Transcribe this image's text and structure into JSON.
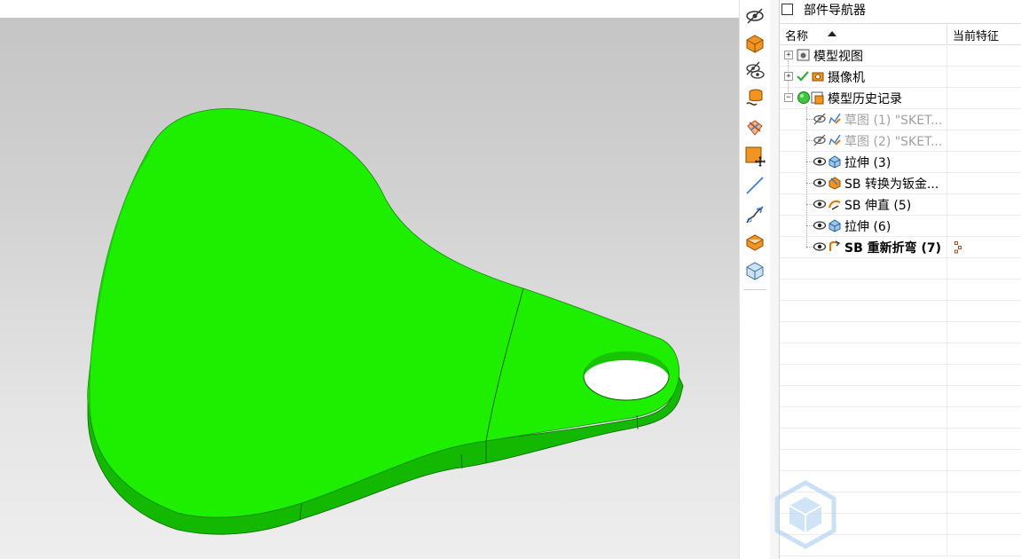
{
  "navigator": {
    "title": "部件导航器",
    "columns": {
      "name": "名称",
      "current_feature": "当前特征"
    },
    "rows": [
      {
        "label": "模型视图",
        "icon": "model-views-icon",
        "expander": "+",
        "style": "normal"
      },
      {
        "label": "摄像机",
        "icon": "camera-icon",
        "expander": "+",
        "style": "normal"
      },
      {
        "label": "模型历史记录",
        "icon": "model-history-icon",
        "expander": "−",
        "style": "normal"
      },
      {
        "label": "草图 (1) \"SKET...",
        "icon": "sketch-icon",
        "visibility": "hidden-eye-icon",
        "style": "dim"
      },
      {
        "label": "草图 (2) \"SKET...",
        "icon": "sketch-icon",
        "visibility": "hidden-eye-icon",
        "style": "dim"
      },
      {
        "label": "拉伸 (3)",
        "icon": "extrude-icon",
        "visibility": "eye-icon",
        "style": "normal"
      },
      {
        "label": "SB 转换为钣金...",
        "icon": "convert-to-sheetmetal-icon",
        "visibility": "eye-icon",
        "style": "normal"
      },
      {
        "label": "SB 伸直 (5)",
        "icon": "unbend-icon",
        "visibility": "eye-icon",
        "style": "normal"
      },
      {
        "label": "拉伸 (6)",
        "icon": "extrude-icon",
        "visibility": "eye-icon",
        "style": "normal"
      },
      {
        "label": "SB 重新折弯 (7)",
        "icon": "rebend-icon",
        "visibility": "eye-icon",
        "style": "bold"
      }
    ]
  },
  "toolbar": {
    "buttons": [
      "hide-icon",
      "solid-body-icon",
      "show-hide-icon",
      "database-link-icon",
      "sheet-metal-icon",
      "move-face-icon",
      "line-icon",
      "bend-tool-icon",
      "shaded-solid-icon",
      "wireframe-cube-icon"
    ]
  },
  "colors": {
    "model_top": "#1eee00",
    "model_side": "#13b800",
    "background_top": "#c5c5c5",
    "background_bottom": "#eeeeee",
    "accent_orange": "#f29421"
  }
}
